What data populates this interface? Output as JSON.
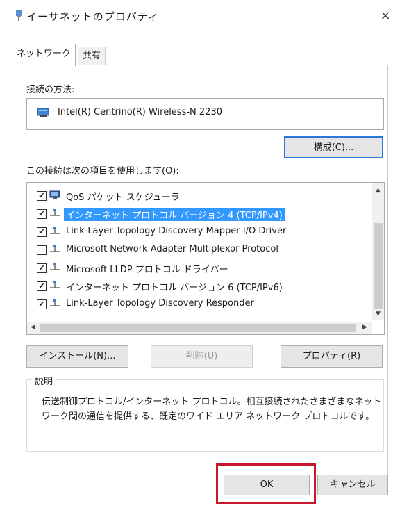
{
  "window": {
    "title": "イーサネットのプロパティ",
    "close_label": "×"
  },
  "tabs": [
    {
      "label": "ネットワーク",
      "active": true
    },
    {
      "label": "共有",
      "active": false
    }
  ],
  "connect_using": {
    "label": "接続の方法:",
    "adapter": "Intel(R) Centrino(R) Wireless-N 2230"
  },
  "configure_button": "構成(C)...",
  "items_label": "この接続は次の項目を使用します(O):",
  "items": [
    {
      "label": "QoS パケット スケジューラ",
      "checked": true,
      "icon": "qos-scheduler-icon",
      "selected": false
    },
    {
      "label": "インターネット プロトコル バージョン 4 (TCP/IPv4)",
      "checked": true,
      "icon": "protocol-icon",
      "selected": true
    },
    {
      "label": "Link-Layer Topology Discovery Mapper I/O Driver",
      "checked": true,
      "icon": "protocol-icon",
      "selected": false
    },
    {
      "label": "Microsoft Network Adapter Multiplexor Protocol",
      "checked": false,
      "icon": "protocol-icon",
      "selected": false
    },
    {
      "label": "Microsoft LLDP プロトコル ドライバー",
      "checked": true,
      "icon": "protocol-icon",
      "selected": false
    },
    {
      "label": "インターネット プロトコル バージョン 6 (TCP/IPv6)",
      "checked": true,
      "icon": "protocol-icon",
      "selected": false
    },
    {
      "label": "Link-Layer Topology Discovery Responder",
      "checked": true,
      "icon": "protocol-icon",
      "selected": false
    }
  ],
  "buttons": {
    "install": "インストール(N)...",
    "uninstall": "削除(U)",
    "properties": "プロパティ(R)"
  },
  "description": {
    "title": "説明",
    "text": "伝送制御プロトコル/インターネット プロトコル。相互接続されたさまざまなネットワーク間の通信を提供する、既定のワイド エリア ネットワーク プロトコルです。"
  },
  "dialog_buttons": {
    "ok": "OK",
    "cancel": "キャンセル"
  },
  "colors": {
    "selection": "#3399ff",
    "highlight_box": "#c8152d",
    "focus_border": "#2a78d7"
  }
}
